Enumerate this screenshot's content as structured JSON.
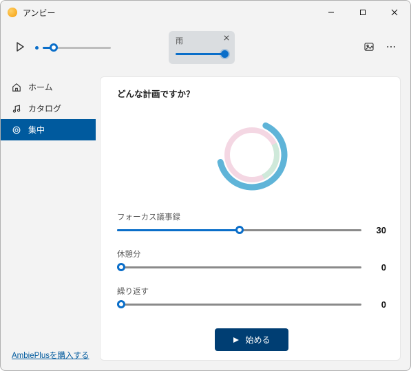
{
  "app": {
    "title": "アンビー"
  },
  "chip": {
    "title": "雨"
  },
  "sidebar": {
    "items": [
      {
        "label": "ホーム"
      },
      {
        "label": "カタログ"
      },
      {
        "label": "集中"
      }
    ],
    "footer_link": "AmbiePlusを購入する"
  },
  "main": {
    "title": "どんな計画ですか？",
    "controls": [
      {
        "label": "フォーカス議事録",
        "value": "30",
        "fill_pct": 50
      },
      {
        "label": "休憩分",
        "value": "0",
        "fill_pct": 0
      },
      {
        "label": "繰り返す",
        "value": "0",
        "fill_pct": 0
      }
    ],
    "start_label": "始める"
  }
}
